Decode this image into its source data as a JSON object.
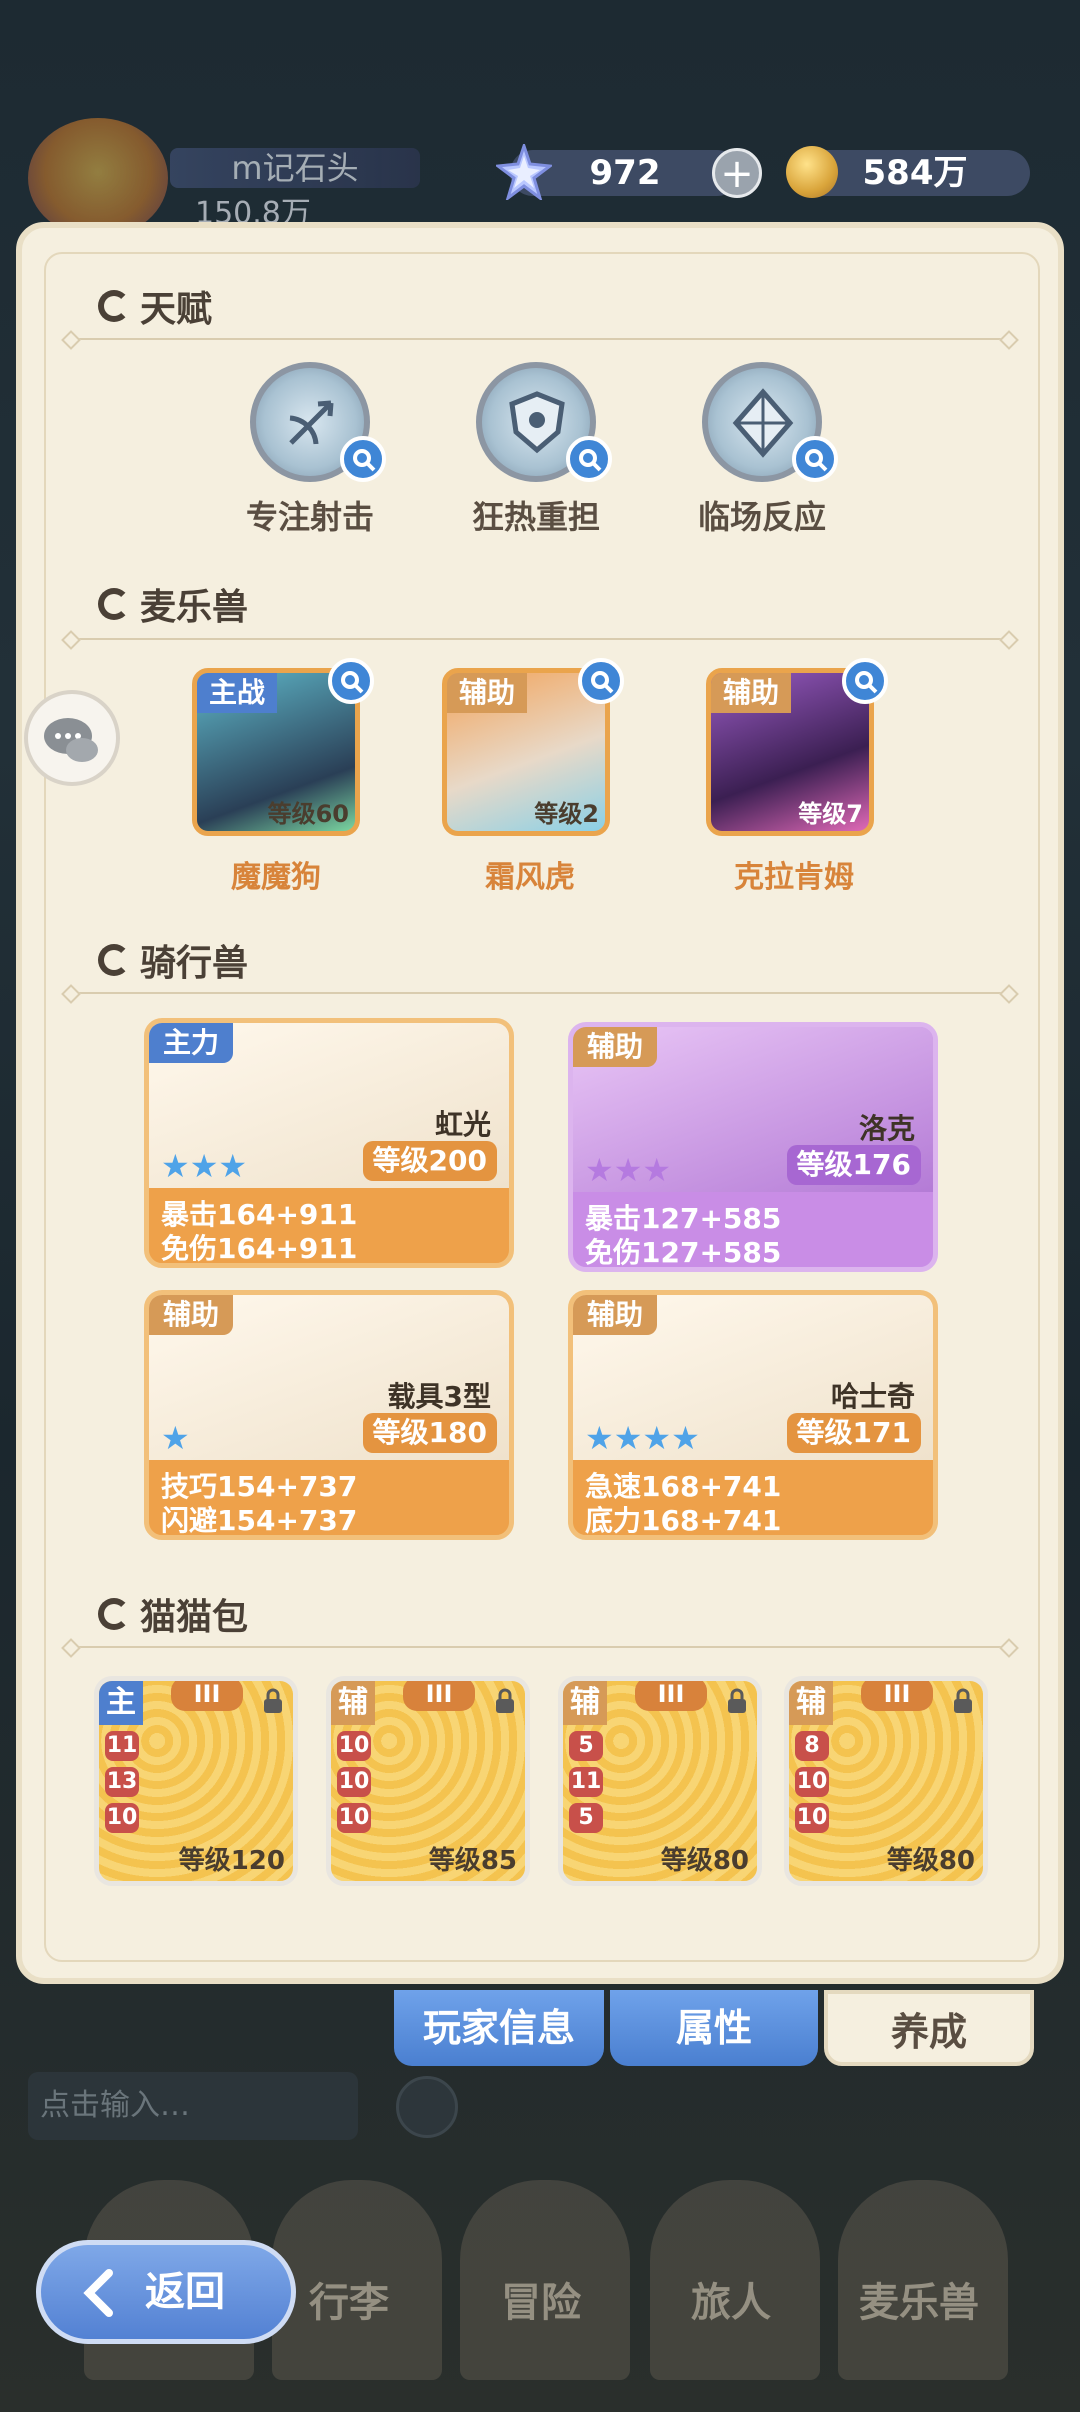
{
  "header": {
    "player_name": "m记石头",
    "player_power": "150.8万",
    "gems": "972",
    "plus": "+",
    "gold": "584万"
  },
  "sections": {
    "talent": "天赋",
    "pets": "麦乐兽",
    "mounts": "骑行兽",
    "catpacks": "猫猫包"
  },
  "talents": [
    {
      "label": "专注射击"
    },
    {
      "label": "狂热重担"
    },
    {
      "label": "临场反应"
    }
  ],
  "pets": [
    {
      "tag": "主战",
      "level": "等级60",
      "name": "魔魔狗",
      "tag_color": "#4e7fce"
    },
    {
      "tag": "辅助",
      "level": "等级2",
      "name": "霜风虎",
      "tag_color": "#d69a57"
    },
    {
      "tag": "辅助",
      "level": "等级7",
      "name": "克拉肯姆",
      "tag_color": "#d69a57"
    }
  ],
  "mounts": [
    {
      "tag": "主力",
      "name": "虹光",
      "level": "等级200",
      "stat1": "暴击164+911",
      "stat2": "免伤164+911",
      "stars": "★★★"
    },
    {
      "tag": "辅助",
      "name": "洛克",
      "level": "等级176",
      "stat1": "暴击127+585",
      "stat2": "免伤127+585",
      "stars": "★★★"
    },
    {
      "tag": "辅助",
      "name": "载具3型",
      "level": "等级180",
      "stat1": "技巧154+737",
      "stat2": "闪避154+737",
      "stars": "★"
    },
    {
      "tag": "辅助",
      "name": "哈士奇",
      "level": "等级171",
      "stat1": "急速168+741",
      "stat2": "底力168+741",
      "stars": "★★★★"
    }
  ],
  "catpacks": [
    {
      "tag": "主",
      "grade": "III",
      "nums": [
        "11",
        "13",
        "10"
      ],
      "level": "等级120"
    },
    {
      "tag": "辅",
      "grade": "III",
      "nums": [
        "10",
        "10",
        "10"
      ],
      "level": "等级85"
    },
    {
      "tag": "辅",
      "grade": "III",
      "nums": [
        "5",
        "11",
        "5"
      ],
      "level": "等级80"
    },
    {
      "tag": "辅",
      "grade": "III",
      "nums": [
        "8",
        "10",
        "10"
      ],
      "level": "等级80"
    }
  ],
  "tabs": {
    "player_info": "玩家信息",
    "attributes": "属性",
    "cultivation": "养成"
  },
  "chat": {
    "placeholder": "点击输入…"
  },
  "nav": {
    "back": "返回",
    "items": [
      "行李",
      "冒险",
      "旅人",
      "麦乐兽"
    ]
  },
  "colors": {
    "accent_blue": "#4e7fce",
    "orange": "#eaa44c",
    "purple": "#c98de6",
    "panel": "#f5efdf"
  }
}
